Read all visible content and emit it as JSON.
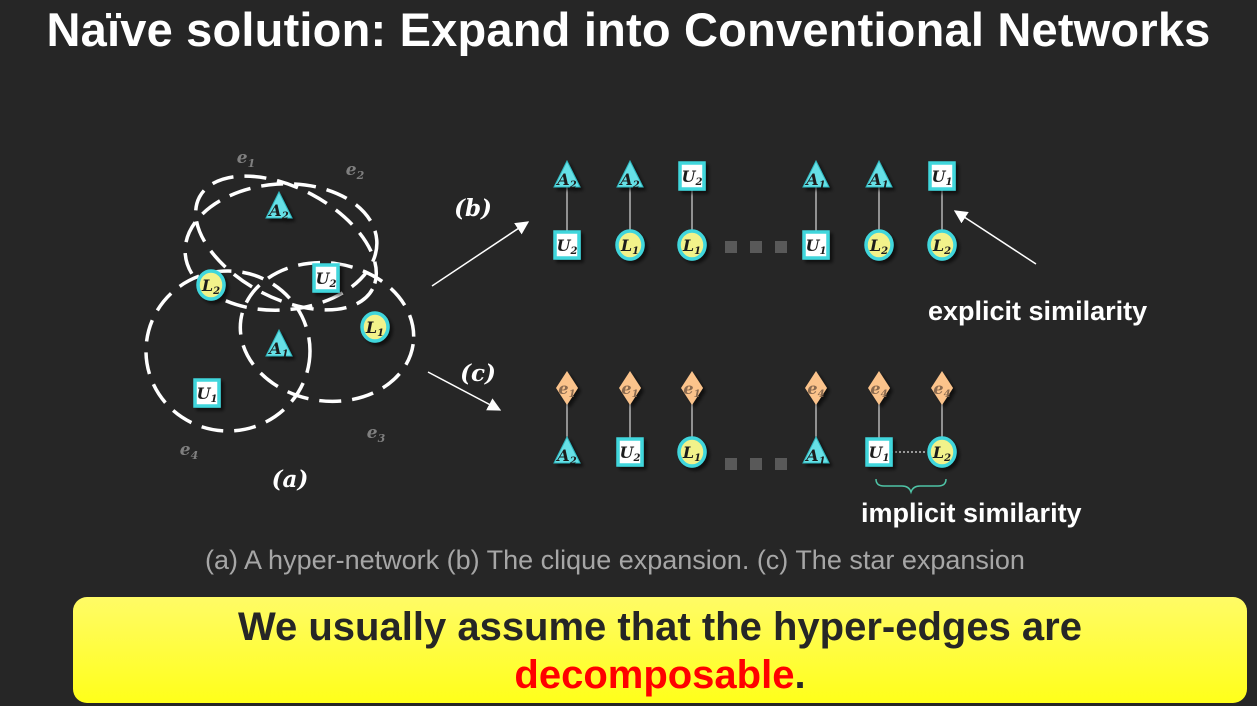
{
  "slide": {
    "title": "Naïve solution: Expand into Conventional Networks",
    "caption": "(a) A hyper-network  (b) The clique expansion. (c) The star expansion",
    "explicit_label": "explicit similarity",
    "implicit_label": "implicit similarity",
    "callout_line1": "We usually assume that the hyper-edges are",
    "callout_highlight": "decomposable",
    "callout_end": "."
  },
  "diagram": {
    "colors": {
      "triangle": "#66e0e6",
      "square_fill": "#ffffff",
      "square_border": "#3fd6dc",
      "circle": "#f2f28a",
      "circle_border": "#3fd6dc",
      "diamond": "#fbc38b",
      "dashed_stroke": "#ffffff",
      "line": "#d9d9d9",
      "ellipsis": "#595959"
    },
    "panel_labels": {
      "a": "(a)",
      "b": "(b)",
      "c": "(c)"
    },
    "hyperedge_labels": [
      {
        "base": "e",
        "sub": "1"
      },
      {
        "base": "e",
        "sub": "2"
      },
      {
        "base": "e",
        "sub": "3"
      },
      {
        "base": "e",
        "sub": "4"
      }
    ],
    "hypernetwork_nodes": [
      {
        "shape": "triangle",
        "base": "A",
        "sub": "2"
      },
      {
        "shape": "circle",
        "base": "L",
        "sub": "2"
      },
      {
        "shape": "square",
        "base": "U",
        "sub": "2"
      },
      {
        "shape": "circle",
        "base": "L",
        "sub": "1"
      },
      {
        "shape": "triangle",
        "base": "A",
        "sub": "1"
      },
      {
        "shape": "square",
        "base": "U",
        "sub": "1"
      }
    ],
    "clique_pairs": [
      {
        "top": {
          "shape": "triangle",
          "base": "A",
          "sub": "2"
        },
        "bottom": {
          "shape": "square",
          "base": "U",
          "sub": "2"
        }
      },
      {
        "top": {
          "shape": "triangle",
          "base": "A",
          "sub": "2"
        },
        "bottom": {
          "shape": "circle",
          "base": "L",
          "sub": "1"
        }
      },
      {
        "top": {
          "shape": "square",
          "base": "U",
          "sub": "2"
        },
        "bottom": {
          "shape": "circle",
          "base": "L",
          "sub": "1"
        }
      },
      {
        "top": {
          "shape": "triangle",
          "base": "A",
          "sub": "1"
        },
        "bottom": {
          "shape": "square",
          "base": "U",
          "sub": "1"
        }
      },
      {
        "top": {
          "shape": "triangle",
          "base": "A",
          "sub": "1"
        },
        "bottom": {
          "shape": "circle",
          "base": "L",
          "sub": "2"
        }
      },
      {
        "top": {
          "shape": "square",
          "base": "U",
          "sub": "1"
        },
        "bottom": {
          "shape": "circle",
          "base": "L",
          "sub": "2"
        }
      }
    ],
    "star_pairs": [
      {
        "top": {
          "shape": "diamond",
          "base": "e",
          "sub": "1"
        },
        "bottom": {
          "shape": "triangle",
          "base": "A",
          "sub": "2"
        }
      },
      {
        "top": {
          "shape": "diamond",
          "base": "e",
          "sub": "1"
        },
        "bottom": {
          "shape": "square",
          "base": "U",
          "sub": "2"
        }
      },
      {
        "top": {
          "shape": "diamond",
          "base": "e",
          "sub": "1"
        },
        "bottom": {
          "shape": "circle",
          "base": "L",
          "sub": "1"
        }
      },
      {
        "top": {
          "shape": "diamond",
          "base": "e",
          "sub": "4"
        },
        "bottom": {
          "shape": "triangle",
          "base": "A",
          "sub": "1"
        }
      },
      {
        "top": {
          "shape": "diamond",
          "base": "e",
          "sub": "4"
        },
        "bottom": {
          "shape": "square",
          "base": "U",
          "sub": "1"
        }
      },
      {
        "top": {
          "shape": "diamond",
          "base": "e",
          "sub": "4"
        },
        "bottom": {
          "shape": "circle",
          "base": "L",
          "sub": "2"
        }
      }
    ]
  }
}
